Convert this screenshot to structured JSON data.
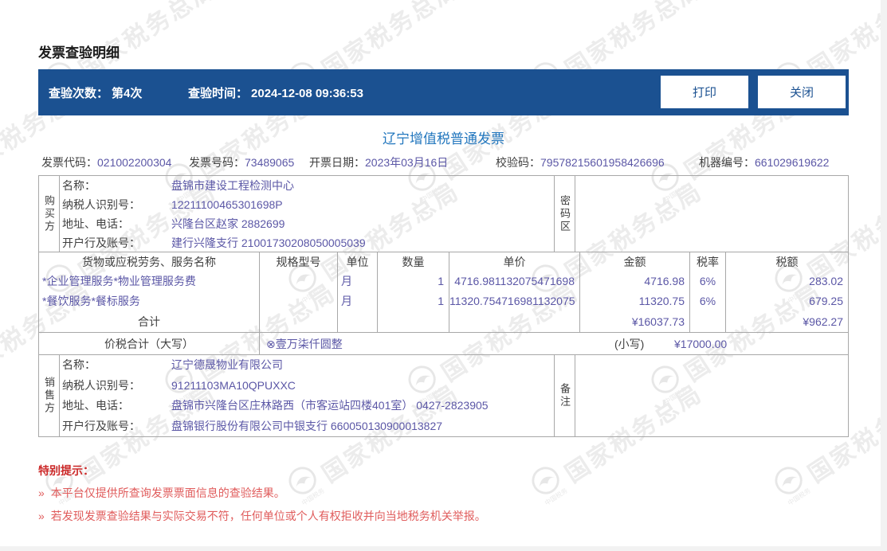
{
  "page": {
    "title": "发票查验明细",
    "watermark_text": "国家税务总局",
    "watermark_small": "中国税务"
  },
  "toolbar": {
    "check_count_label": "查验次数：",
    "check_count_value": "第4次",
    "check_time_label": "查验时间：",
    "check_time_value": "2024-12-08 09:36:53",
    "print_label": "打印",
    "close_label": "关闭"
  },
  "invoice": {
    "title": "辽宁增值税普通发票",
    "meta": [
      {
        "label": "发票代码：",
        "value": "021002200304"
      },
      {
        "label": "发票号码：",
        "value": "73489065"
      },
      {
        "label": "开票日期：",
        "value": "2023年03月16日"
      },
      {
        "label": "校验码：",
        "value": "79578215601958426696"
      },
      {
        "label": "机器编号：",
        "value": "661029619622"
      }
    ],
    "buyer": {
      "side_label": "购买方",
      "rows": [
        {
          "label": "名称：",
          "value": "盘锦市建设工程检测中心"
        },
        {
          "label": "纳税人识别号：",
          "value": "12211100465301698P"
        },
        {
          "label": "地址、电话：",
          "value": "兴隆台区赵家 2882699"
        },
        {
          "label": "开户行及账号：",
          "value": "建行兴隆支行 21001730208050005039"
        }
      ],
      "password_label": "密码区",
      "password_value": ""
    },
    "items_table": {
      "headers": [
        "货物或应税劳务、服务名称",
        "规格型号",
        "单位",
        "数量",
        "单价",
        "金额",
        "税率",
        "税额"
      ],
      "rows": [
        {
          "name": "*企业管理服务*物业管理服务费",
          "spec": "",
          "unit": "月",
          "qty": "1",
          "price": "4716.981132075471698",
          "amount": "4716.98",
          "tax_rate": "6%",
          "tax": "283.02"
        },
        {
          "name": "*餐饮服务*餐标服务",
          "spec": "",
          "unit": "月",
          "qty": "1",
          "price": "11320.754716981132075",
          "amount": "11320.75",
          "tax_rate": "6%",
          "tax": "679.25"
        }
      ],
      "total_label": "合计",
      "total_amount": "¥16037.73",
      "total_tax": "¥962.27"
    },
    "total_row": {
      "label": "价税合计（大写）",
      "amount_words": "⊗壹万柒仟圆整",
      "small_label": "(小写)",
      "amount_figures": "¥17000.00"
    },
    "seller": {
      "side_label": "销售方",
      "rows": [
        {
          "label": "名称：",
          "value": "辽宁德晟物业有限公司"
        },
        {
          "label": "纳税人识别号：",
          "value": "91211103MA10QPUXXC"
        },
        {
          "label": "地址、电话：",
          "value": "盘锦市兴隆台区庄林路西（市客运站四楼401室） 0427-2823905"
        },
        {
          "label": "开户行及账号：",
          "value": "盘锦银行股份有限公司中银支行 660050130900013827"
        }
      ],
      "remark_label": "备注",
      "remark_value": ""
    }
  },
  "notice": {
    "title": "特别提示：",
    "items": [
      "本平台仅提供所查询发票票面信息的查验结果。",
      "若发现发票查验结果与实际交易不符，任何单位或个人有权拒收并向当地税务机关举报。"
    ]
  },
  "colors": {
    "bar_bg": "#1b5191",
    "title_blue": "#2377be",
    "value_purple": "#5b57a6",
    "notice_red": "#e05c5c",
    "notice_title_red": "#cc2929",
    "border_gray": "#a8a8a8"
  }
}
